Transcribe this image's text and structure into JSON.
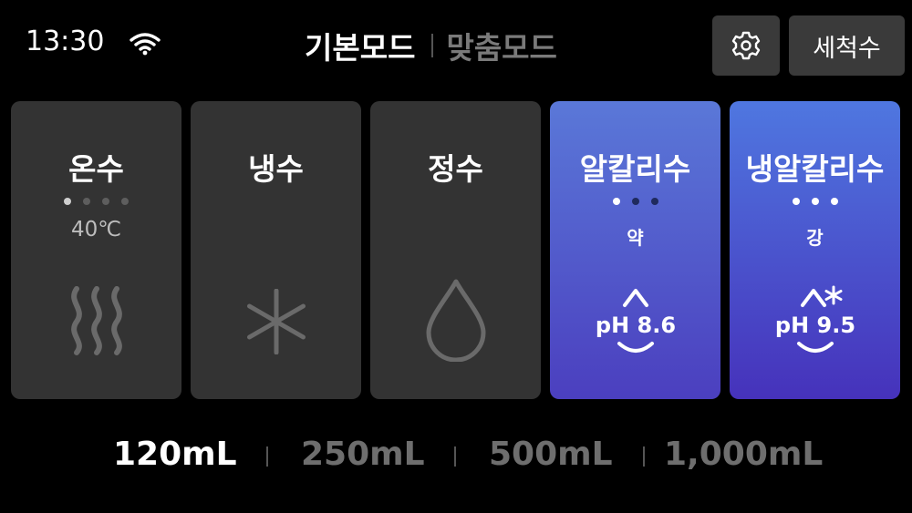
{
  "status": {
    "time": "13:30"
  },
  "modes": {
    "active": "기본모드",
    "inactive": "맞춤모드"
  },
  "header": {
    "wash_label": "세척수"
  },
  "cards": [
    {
      "title": "온수",
      "sub": "40℃",
      "dots_total": 4,
      "dots_on": 1,
      "icon": "heat-waves-icon"
    },
    {
      "title": "냉수",
      "icon": "snowflake-icon"
    },
    {
      "title": "정수",
      "icon": "water-drop-icon"
    },
    {
      "title": "알칼리수",
      "sub": "약",
      "dots_total": 3,
      "ph": "pH 8.6",
      "icon": "ph-alkaline-icon"
    },
    {
      "title": "냉알칼리수",
      "sub": "강",
      "dots_total": 3,
      "ph": "pH 9.5",
      "icon": "ph-alkaline-cold-icon"
    }
  ],
  "volumes": [
    {
      "label": "120mL",
      "selected": true
    },
    {
      "label": "250mL",
      "selected": false
    },
    {
      "label": "500mL",
      "selected": false
    },
    {
      "label": "1,000mL",
      "selected": false
    }
  ],
  "colors": {
    "card_gray": "#333333",
    "card_blue_top": "#5b78d6",
    "card_blue_bottom": "#4a3bbd",
    "text_inactive": "#6e6e6e"
  }
}
